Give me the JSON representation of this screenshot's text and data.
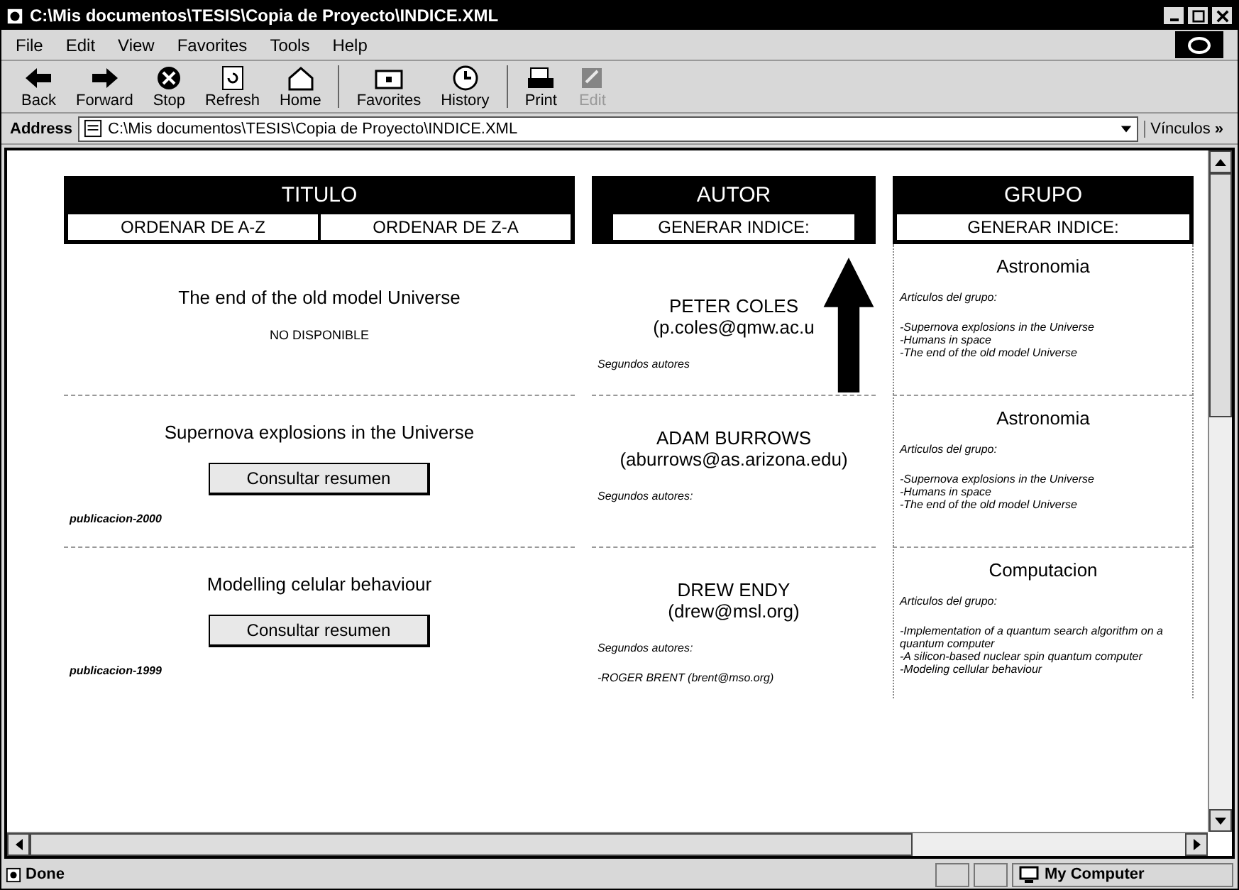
{
  "window": {
    "title": "C:\\Mis documentos\\TESIS\\Copia de Proyecto\\INDICE.XML"
  },
  "menu": [
    "File",
    "Edit",
    "View",
    "Favorites",
    "Tools",
    "Help"
  ],
  "toolbar": [
    {
      "kind": "back",
      "label": "Back",
      "disabled": false
    },
    {
      "kind": "forward",
      "label": "Forward",
      "disabled": false
    },
    {
      "kind": "stop",
      "label": "Stop",
      "disabled": false
    },
    {
      "kind": "refresh",
      "label": "Refresh",
      "disabled": false
    },
    {
      "kind": "home",
      "label": "Home",
      "disabled": false
    },
    {
      "kind": "favorites",
      "label": "Favorites",
      "disabled": false
    },
    {
      "kind": "history",
      "label": "History",
      "disabled": false
    },
    {
      "kind": "print",
      "label": "Print",
      "disabled": false
    },
    {
      "kind": "edit",
      "label": "Edit",
      "disabled": true
    }
  ],
  "address": {
    "label": "Address",
    "value": "C:\\Mis documentos\\TESIS\\Copia de Proyecto\\INDICE.XML"
  },
  "links": {
    "label": "Vínculos",
    "chevron": "»"
  },
  "columns": [
    {
      "title": "TITULO",
      "buttons": [
        "ORDENAR DE A-Z",
        "ORDENAR DE Z-A"
      ]
    },
    {
      "title": "AUTOR",
      "buttons": [
        "GENERAR INDICE:"
      ]
    },
    {
      "title": "GRUPO",
      "buttons": [
        "GENERAR INDICE:"
      ]
    }
  ],
  "rows": [
    {
      "title": "The end of the old model Universe",
      "note": "NO DISPONIBLE",
      "author": "PETER COLES",
      "email": "(p.coles@qmw.ac.u",
      "coauthors_label": "Segundos autores",
      "coauthors": [],
      "group": "Astronomia",
      "group_label": "Articulos del grupo:",
      "articles": [
        "-Supernova explosions in the Universe",
        "-Humans in space",
        "-The end of the old model Universe"
      ]
    },
    {
      "title": "Supernova explosions in the Universe",
      "action": "Consultar resumen",
      "publication": "publicacion-2000",
      "author": "ADAM BURROWS",
      "email": "(aburrows@as.arizona.edu)",
      "coauthors_label": "Segundos autores:",
      "coauthors": [],
      "group": "Astronomia",
      "group_label": "Articulos del grupo:",
      "articles": [
        "-Supernova explosions in the Universe",
        "-Humans in space",
        "-The end of the old model Universe"
      ]
    },
    {
      "title": "Modelling celular behaviour",
      "action": "Consultar resumen",
      "publication": "publicacion-1999",
      "author": "DREW ENDY",
      "email": "(drew@msl.org)",
      "coauthors_label": "Segundos autores:",
      "coauthors": [
        "-ROGER BRENT (brent@mso.org)"
      ],
      "group": "Computacion",
      "group_label": "Articulos del grupo:",
      "articles": [
        "-Implementation of a quantum search algorithm on a quantum computer",
        "-A silicon-based nuclear spin quantum computer",
        "-Modeling cellular behaviour"
      ]
    }
  ],
  "status": {
    "text": "Done",
    "zone": "My Computer"
  }
}
